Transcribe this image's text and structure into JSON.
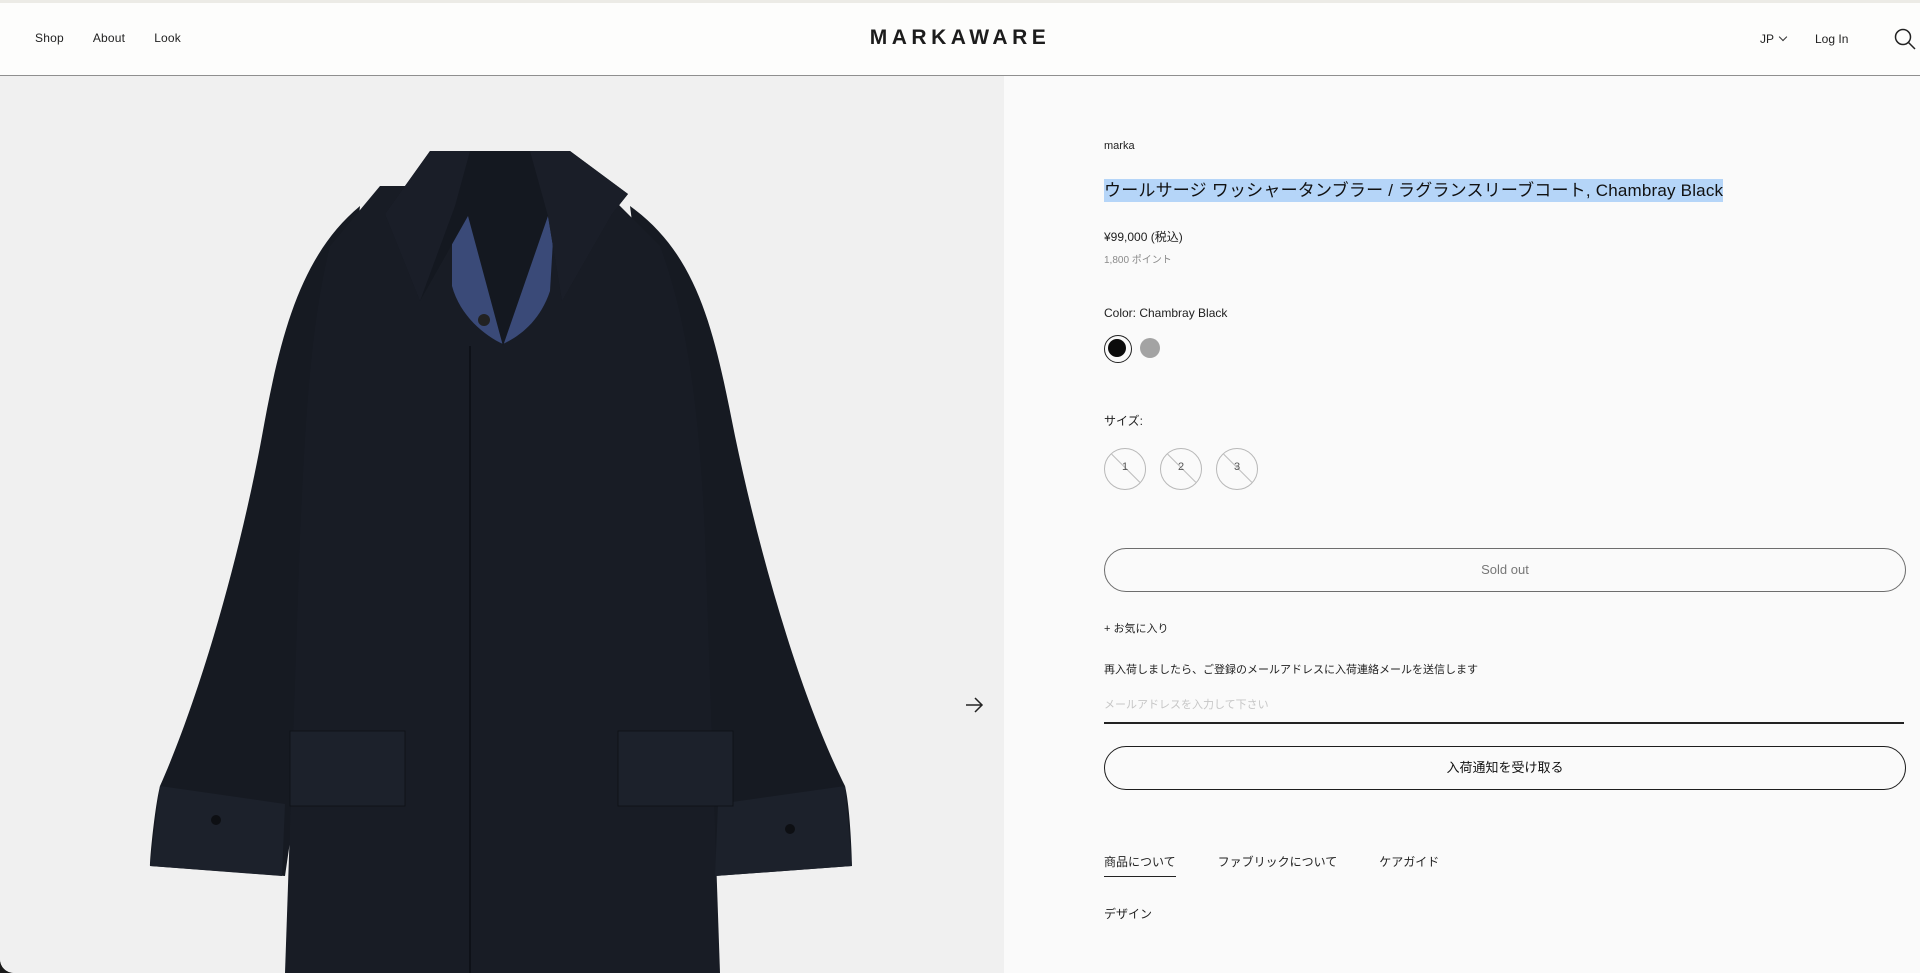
{
  "header": {
    "nav": [
      "Shop",
      "About",
      "Look"
    ],
    "logo": "MARKAWARE",
    "language": "JP",
    "login": "Log In",
    "search_icon": "search-icon"
  },
  "gallery": {
    "next_icon": "arrow-right-icon"
  },
  "product": {
    "brand": "marka",
    "title": "ウールサージ ワッシャータンブラー / ラグランスリーブコート, Chambray Black",
    "price": "¥99,000 (税込)",
    "points": "1,800 ポイント",
    "color_label": "Color: Chambray Black",
    "colors": [
      {
        "name": "Chambray Black",
        "hex": "#0b0b0b",
        "selected": true
      },
      {
        "name": "Grey",
        "hex": "#a3a3a3",
        "selected": false
      }
    ],
    "size_label": "サイズ:",
    "sizes": [
      "1",
      "2",
      "3"
    ],
    "sold_out": "Sold out",
    "favorite": "+ お気に入り",
    "restock_text": "再入荷しましたら、ご登録のメールアドレスに入荷連絡メールを送信します",
    "email_placeholder": "メールアドレスを入力して下さい",
    "notify_button": "入荷通知を受け取る",
    "tabs": [
      "商品について",
      "ファブリックについて",
      "ケアガイド"
    ],
    "section_heading": "デザイン"
  }
}
